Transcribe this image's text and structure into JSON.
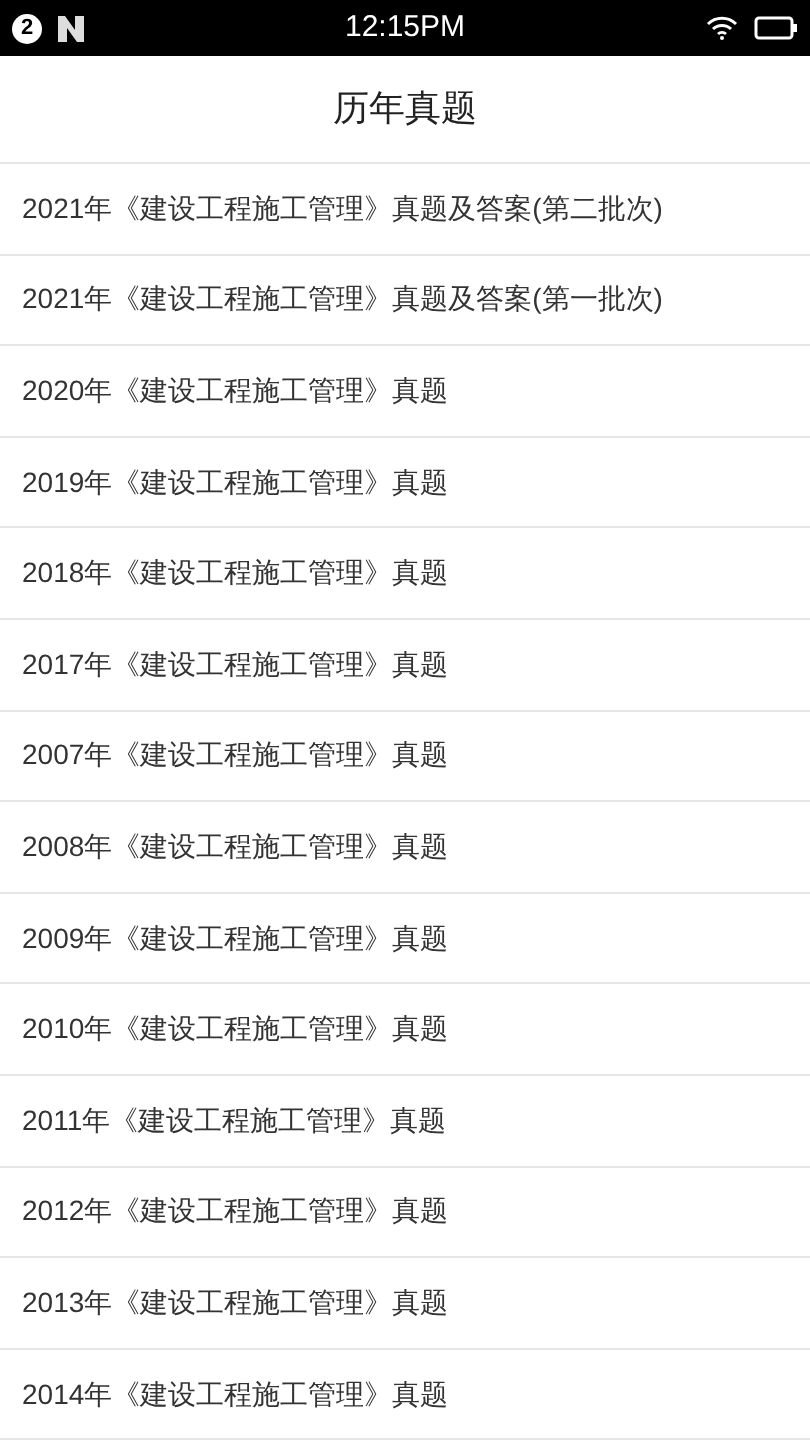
{
  "status_bar": {
    "notification_count": "2",
    "time": "12:15PM"
  },
  "header": {
    "title": "历年真题"
  },
  "list": [
    {
      "label": "2021年《建设工程施工管理》真题及答案(第二批次)"
    },
    {
      "label": "2021年《建设工程施工管理》真题及答案(第一批次)"
    },
    {
      "label": "2020年《建设工程施工管理》真题"
    },
    {
      "label": "2019年《建设工程施工管理》真题"
    },
    {
      "label": "2018年《建设工程施工管理》真题"
    },
    {
      "label": "2017年《建设工程施工管理》真题"
    },
    {
      "label": "2007年《建设工程施工管理》真题"
    },
    {
      "label": "2008年《建设工程施工管理》真题"
    },
    {
      "label": "2009年《建设工程施工管理》真题"
    },
    {
      "label": "2010年《建设工程施工管理》真题"
    },
    {
      "label": "2011年《建设工程施工管理》真题"
    },
    {
      "label": "2012年《建设工程施工管理》真题"
    },
    {
      "label": "2013年《建设工程施工管理》真题"
    },
    {
      "label": "2014年《建设工程施工管理》真题"
    }
  ]
}
